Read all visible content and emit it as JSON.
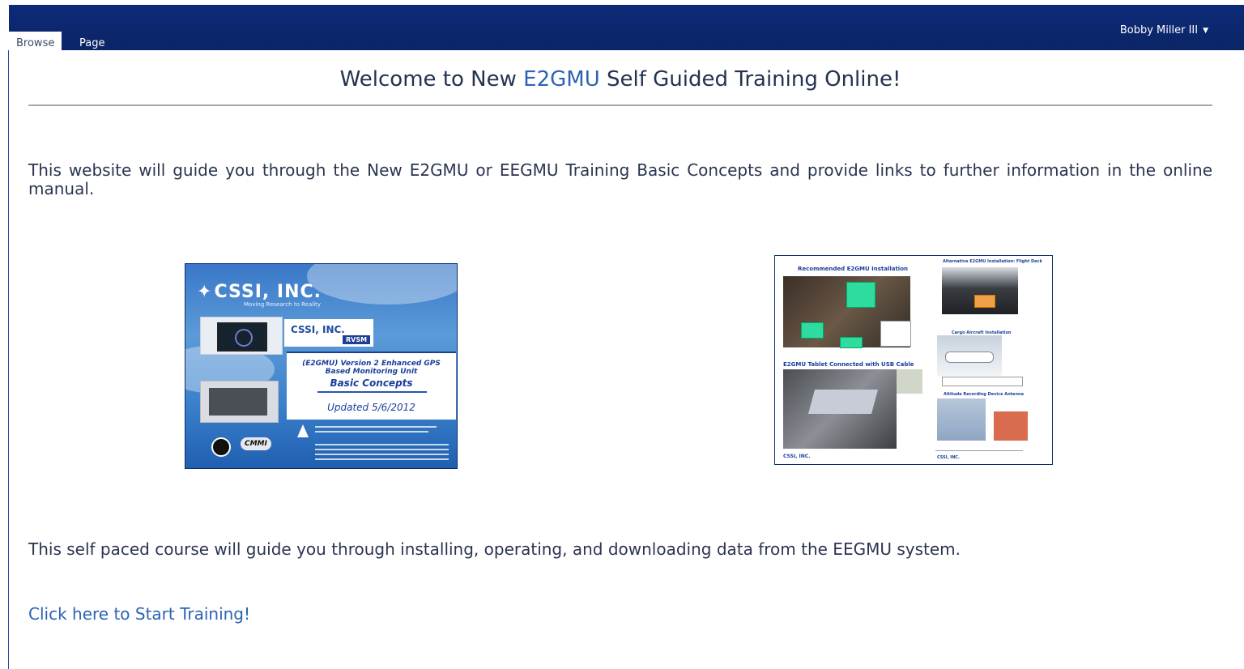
{
  "ribbon": {
    "tabs": [
      {
        "label": "Browse",
        "active": true
      },
      {
        "label": "Page",
        "active": false
      }
    ],
    "user_name": "Bobby Miller III"
  },
  "page": {
    "title_prefix": "Welcome to New ",
    "title_brand": "E2GMU",
    "title_suffix": " Self Guided Training Online!",
    "intro": "This website will guide you through the New E2GMU or EEGMU Training Basic Concepts and provide links to further information in the online manual.",
    "course": "This self paced course will guide you through installing, operating, and downloading data from the EEGMU system.",
    "start_link": "Click here to Start Training!"
  },
  "cover_image": {
    "company": "CSSI, INC.",
    "tagline": "Moving Research to Reality",
    "rvsm_company": "CSSI, INC.",
    "rvsm_badge": "RVSM",
    "line1": "(E2GMU) Version 2 Enhanced GPS",
    "line2": "Based Monitoring Unit",
    "line3": "Basic Concepts",
    "updated": "Updated 5/6/2012",
    "cmmi": "CMMI"
  },
  "diagram_image": {
    "h1": "Recommended E2GMU Installation",
    "h2": "Alternative E2GMU Installation: Flight Deck",
    "h3": "E2GMU Tablet Connected with USB Cable",
    "h4": "Cargo Aircraft Installation",
    "h5": "Altitude Recording Device Antenna",
    "footer_logo": "CSSI, INC."
  },
  "colors": {
    "ribbon": "#0b2566",
    "link": "#2c63b5",
    "text": "#2a3550"
  }
}
